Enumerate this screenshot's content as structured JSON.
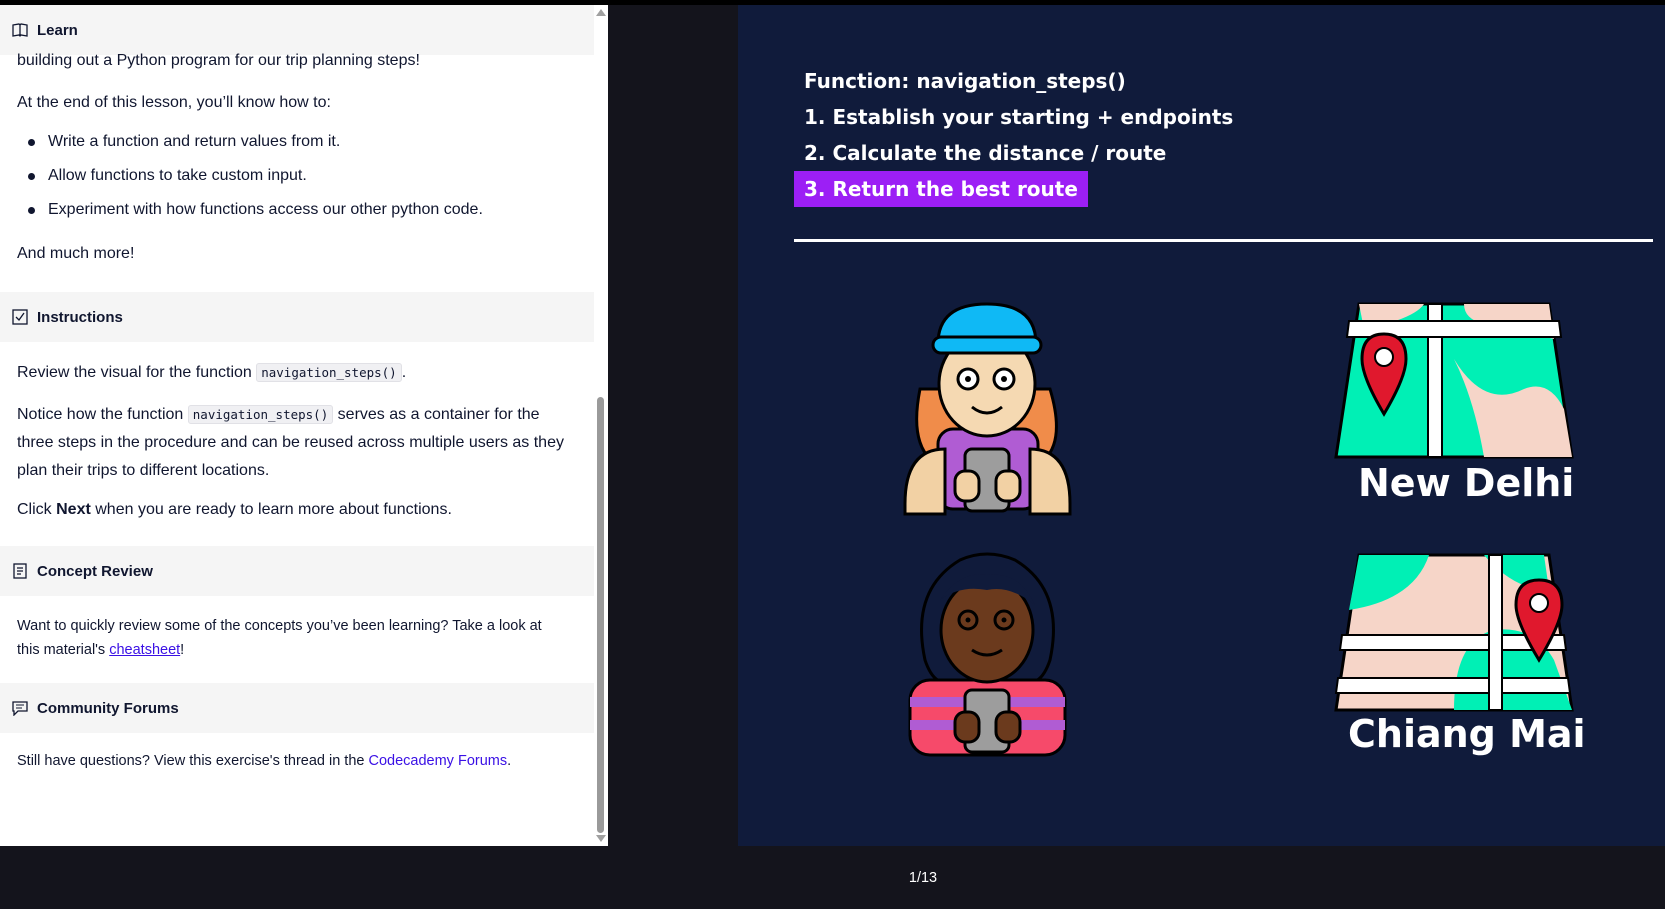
{
  "learn": {
    "heading": "Learn",
    "intro_tail": "building out a Python program for our trip planning steps!",
    "lead": "At the end of this lesson, you’ll know how to:",
    "bullets": [
      "Write a function and return values from it.",
      "Allow functions to take custom input.",
      "Experiment with how functions access our other python code."
    ],
    "outro": "And much more!"
  },
  "instructions": {
    "heading": "Instructions",
    "p1_pre": "Review the visual for the function ",
    "p1_code": "navigation_steps()",
    "p1_post": ".",
    "p2_pre": "Notice how the function ",
    "p2_code": "navigation_steps()",
    "p2_post": " serves as a container for the three steps in the procedure and can be reused across multiple users as they plan their trips to different locations.",
    "p3_pre": "Click ",
    "p3_bold": "Next",
    "p3_post": " when you are ready to learn more about functions."
  },
  "concept_review": {
    "heading": "Concept Review",
    "text_pre": "Want to quickly review some of the concepts you’ve been learning? Take a look at this material's ",
    "link": "cheatsheet",
    "text_post": "!"
  },
  "community": {
    "heading": "Community Forums",
    "text_pre": "Still have questions? View this exercise's thread in the ",
    "link": "Codecademy Forums",
    "text_post": "."
  },
  "slide": {
    "line1": "Function: navigation_steps()",
    "line2": "1. Establish your starting + endpoints",
    "line3": "2. Calculate the distance / route",
    "line4": "3. Return the best route",
    "city1": "New Delhi",
    "city2": "Chiang Mai"
  },
  "pager": "1/13",
  "colors": {
    "slide_bg": "#101b3b",
    "highlight": "#9c1ff5",
    "map_green": "#00f0b5",
    "map_pink": "#f6d5c8",
    "pin_red": "#e0182d",
    "link": "#3a10e5"
  }
}
